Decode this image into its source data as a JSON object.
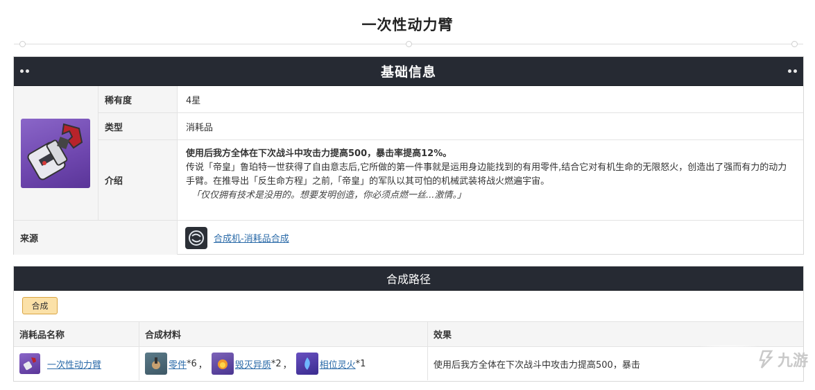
{
  "page_title": "一次性动力臂",
  "basic": {
    "header": "基础信息",
    "rows": [
      {
        "key": "稀有度",
        "value": "4星"
      },
      {
        "key": "类型",
        "value": "消耗品"
      }
    ],
    "intro_key": "介绍",
    "intro_bold": "使用后我方全体在下次战斗中攻击力提高500，暴击率提高12%。",
    "intro_text": "传说「帝皇」鲁珀特一世获得了自由意志后,它所做的第一件事就是运用身边能找到的有用零件,结合它对有机生命的无限怒火，创造出了强而有力的动力手臂。在推导出「反生命方程」之前,「帝皇」的军队以其可怕的机械武装将战火燃遍宇宙。",
    "intro_quote": "「仅仅拥有技术是没用的。想要发明创造，你必须点燃一丝...激情。」",
    "source_key": "来源",
    "source_link": "合成机-消耗品合成"
  },
  "synthesis": {
    "header": "合成路径",
    "tab": "合成",
    "columns": [
      "消耗品名称",
      "合成材料",
      "效果"
    ],
    "row": {
      "name": "一次性动力臂",
      "materials": [
        {
          "name": "零件",
          "qty": "*6",
          "sep": "，",
          "icon": "gear-part-icon"
        },
        {
          "name": "毁灭异质",
          "qty": "*2",
          "sep": "，",
          "icon": "fire-orb-icon"
        },
        {
          "name": "相位灵火",
          "qty": "*1",
          "sep": "",
          "icon": "blue-flame-icon"
        }
      ],
      "effect": "使用后我方全体在下次战斗中攻击力提高500，暴击"
    }
  },
  "watermark": "九游",
  "colors": {
    "header_bg": "#262a33",
    "tab_bg": "#fbe1a8",
    "link": "#2a6aa8",
    "item_bg": "#6e46ae"
  }
}
